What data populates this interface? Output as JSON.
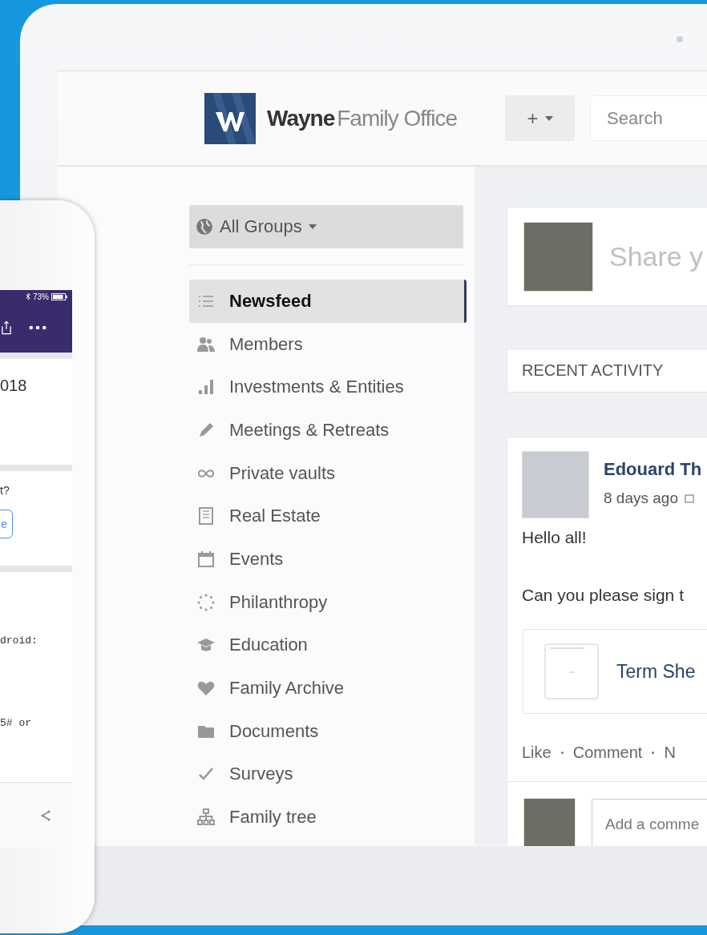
{
  "phone": {
    "battery": "73%",
    "cards": [
      {
        "kind": "text",
        "text": "018"
      },
      {
        "kind": "question",
        "text": "t?",
        "button": "e"
      },
      {
        "kind": "code",
        "lines": [
          "droid:",
          "5# or"
        ]
      }
    ]
  },
  "header": {
    "logo": {
      "bold": "Wayne",
      "light": "Family Office"
    },
    "add_button": "+",
    "search": {
      "placeholder": "Search"
    }
  },
  "sidebar": {
    "group_selector": "All Groups",
    "items": [
      {
        "label": "Newsfeed",
        "selected": true
      },
      {
        "label": "Members",
        "selected": false
      },
      {
        "label": "Investments & Entities",
        "selected": false
      },
      {
        "label": "Meetings & Retreats",
        "selected": false
      },
      {
        "label": "Private vaults",
        "selected": false
      },
      {
        "label": "Real Estate",
        "selected": false
      },
      {
        "label": "Events",
        "selected": false
      },
      {
        "label": "Philanthropy",
        "selected": false
      },
      {
        "label": "Education",
        "selected": false
      },
      {
        "label": "Family Archive",
        "selected": false
      },
      {
        "label": "Documents",
        "selected": false
      },
      {
        "label": "Surveys",
        "selected": false
      },
      {
        "label": "Family tree",
        "selected": false
      }
    ]
  },
  "share": {
    "placeholder": "Share y"
  },
  "recent_activity": "RECENT ACTIVITY",
  "post": {
    "author": "Edouard Th",
    "time": "8 days ago",
    "paragraphs": [
      "Hello all!",
      "Can you please sign t"
    ],
    "attachment": "Term She",
    "actions": [
      "Like",
      "Comment",
      "N"
    ],
    "comment_placeholder": "Add a comme"
  }
}
